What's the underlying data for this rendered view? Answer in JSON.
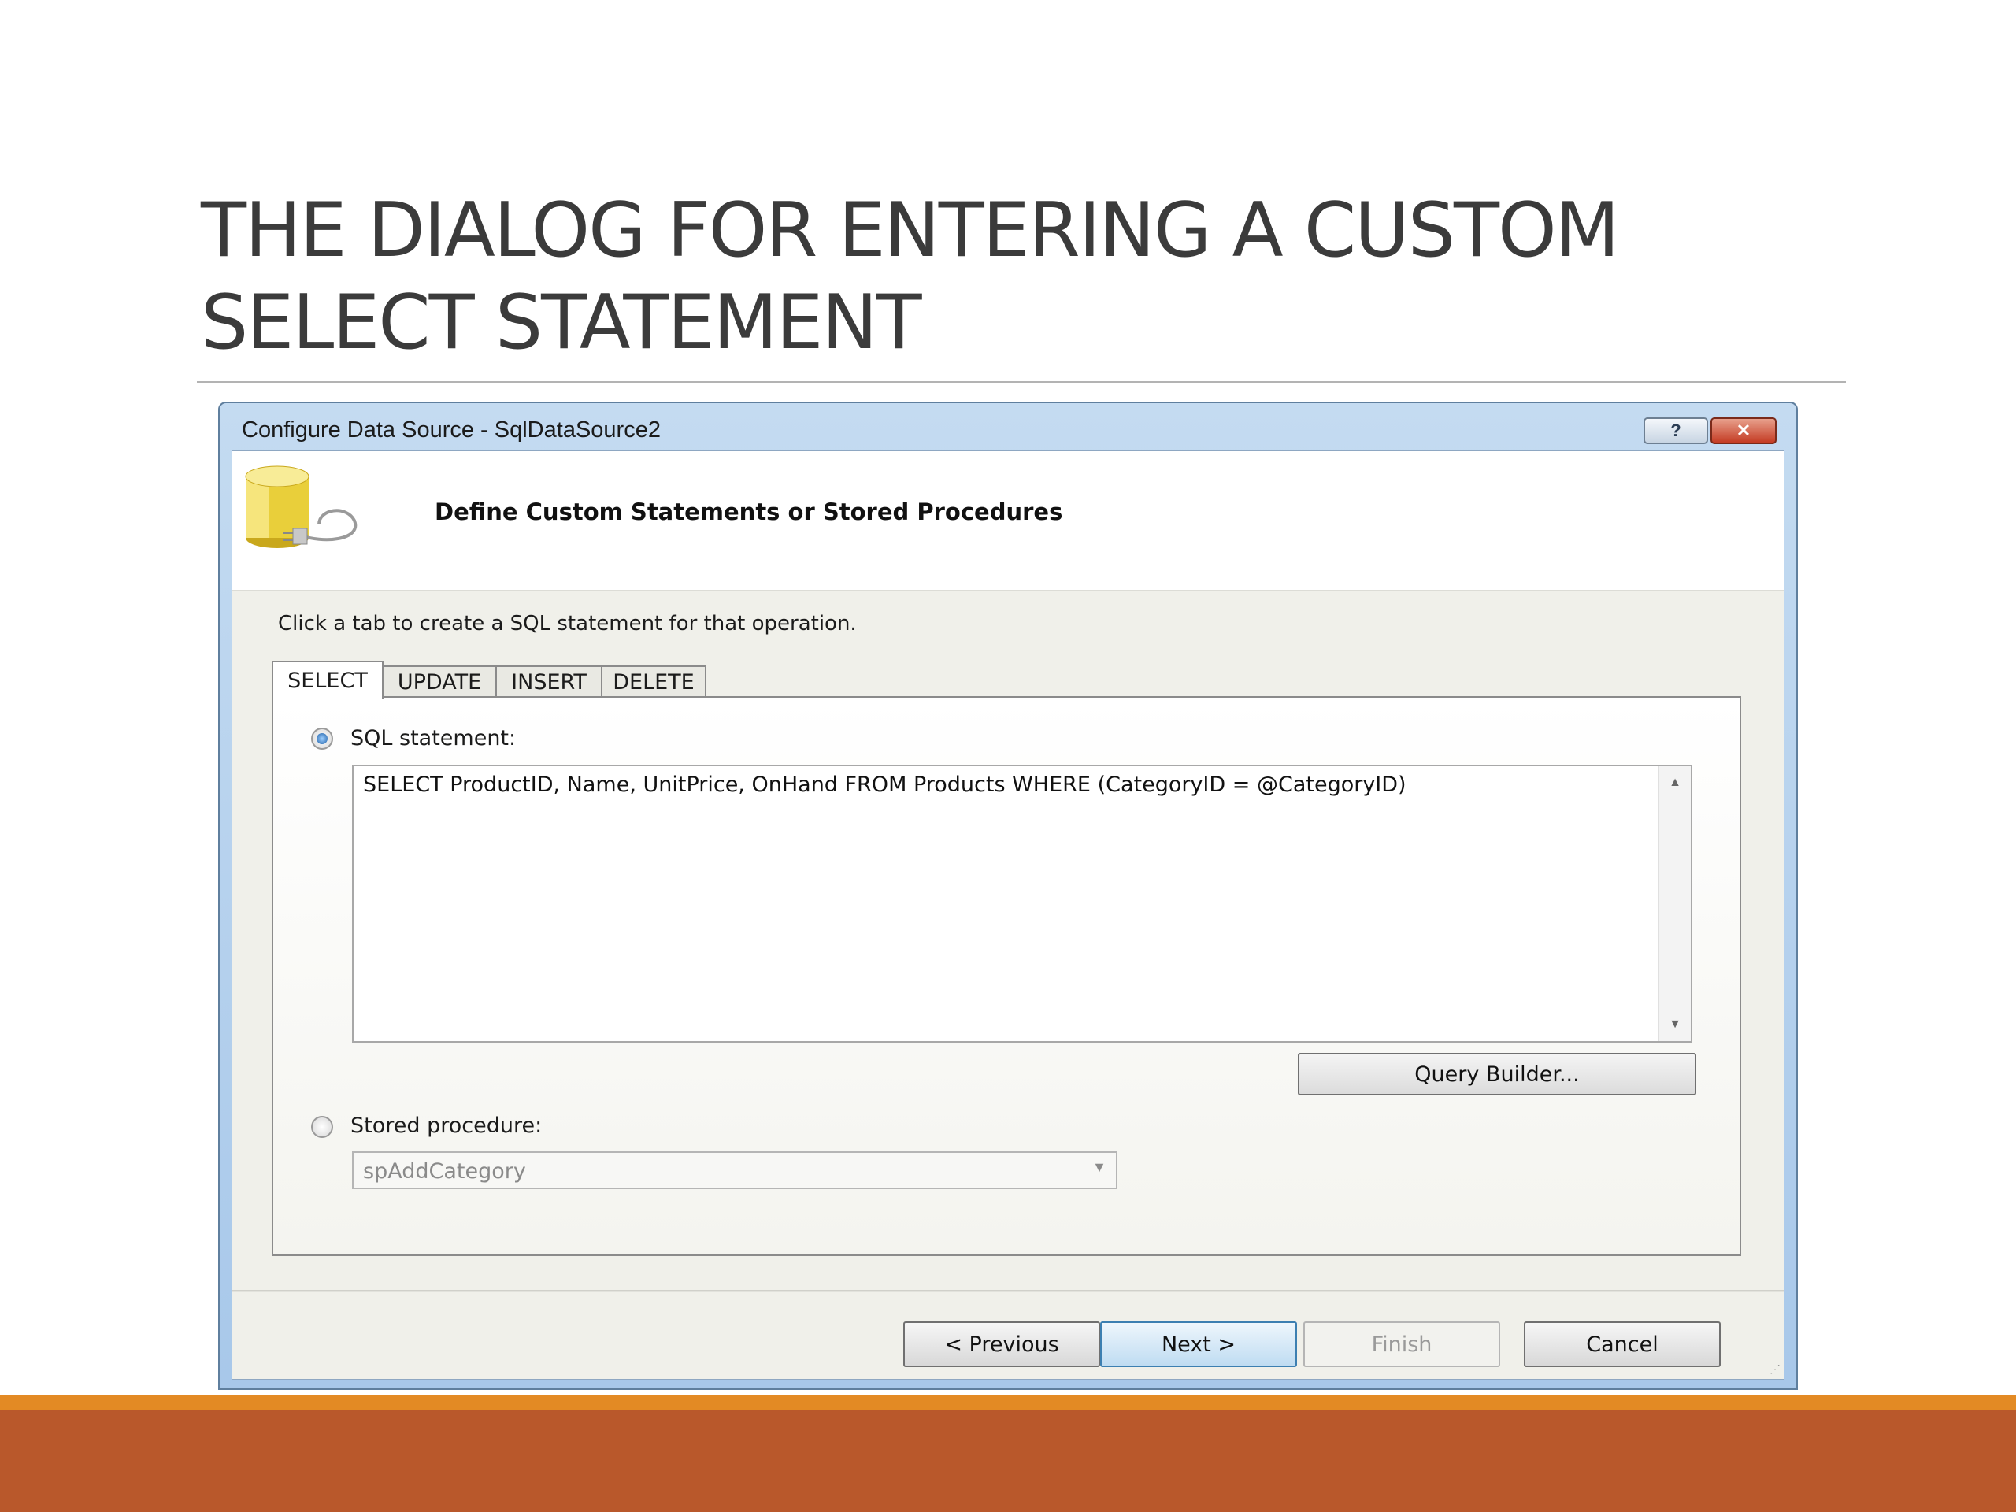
{
  "slide": {
    "title": "THE DIALOG FOR ENTERING A CUSTOM\nSELECT STATEMENT"
  },
  "dialog": {
    "title": "Configure Data Source - SqlDataSource2",
    "help_label": "?",
    "close_label": "✕",
    "header": "Define Custom Statements or Stored Procedures",
    "instruction": "Click a tab to create a SQL statement for that operation.",
    "tabs": [
      {
        "label": "SELECT",
        "active": true
      },
      {
        "label": "UPDATE",
        "active": false
      },
      {
        "label": "INSERT",
        "active": false
      },
      {
        "label": "DELETE",
        "active": false
      }
    ],
    "sql_option": {
      "label": "SQL statement:",
      "selected": true,
      "value": "SELECT ProductID, Name, UnitPrice, OnHand FROM Products WHERE (CategoryID = @CategoryID)"
    },
    "query_builder_label": "Query Builder...",
    "stored_option": {
      "label": "Stored procedure:",
      "selected": false,
      "value": "spAddCategory"
    },
    "buttons": {
      "previous": "< Previous",
      "next": "Next >",
      "finish": "Finish",
      "cancel": "Cancel"
    }
  },
  "icons": [
    "database-icon",
    "plug-icon",
    "help-icon",
    "close-icon",
    "scroll-up-icon",
    "scroll-down-icon",
    "chevron-down-icon"
  ],
  "colors": {
    "title_text": "#3b3b3b",
    "bottom_band": "#b9582b",
    "bottom_stripe": "#e38a24",
    "dialog_frame": "#b5d0ec"
  }
}
